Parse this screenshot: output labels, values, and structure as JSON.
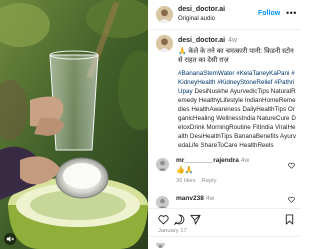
{
  "post": {
    "username": "desi_doctor.ai",
    "audio": "Original audio",
    "follow_label": "Follow",
    "more_label": "•••",
    "date": "January 17"
  },
  "caption": {
    "username": "desi_doctor.ai",
    "time": "4w",
    "hindi": "🙏 केले के तने का चमत्कारी पानी: किडनी स्टोन से राहत का देसी राज़",
    "tags": "#BananaStemWater #KelaTaneyKaPani #KidneyHealth #KidneyStoneRelief #PathriUpay DesiNuskhe AyurvedicTips NaturalRemedy HealthyLifestyle IndianHomeRemedies HealthAwareness DailyHealthTips OrganicHealing WellnessIndia NatureCure DetoxDrink MorningRoutine FitIndia ViralHealth DesiHealthTips BananaBenefits AyurvedaLife ShareToCare HealthReels"
  },
  "comments": [
    {
      "username": "mr________rajendra",
      "time": "4w",
      "text": "",
      "emoji": "👍🙏",
      "likes": "36 likes",
      "reply": "Reply"
    },
    {
      "username": "manv238",
      "time": "4w",
      "text": "",
      "emoji": "",
      "likes": "",
      "reply": ""
    }
  ],
  "icons": {
    "like": "heart-icon",
    "comment": "comment-icon",
    "share": "share-icon",
    "save": "bookmark-icon",
    "mute": "speaker-off-icon"
  },
  "colors": {
    "accent": "#0095f6",
    "hashtag": "#00376b",
    "muted": "#8e8e8e"
  }
}
